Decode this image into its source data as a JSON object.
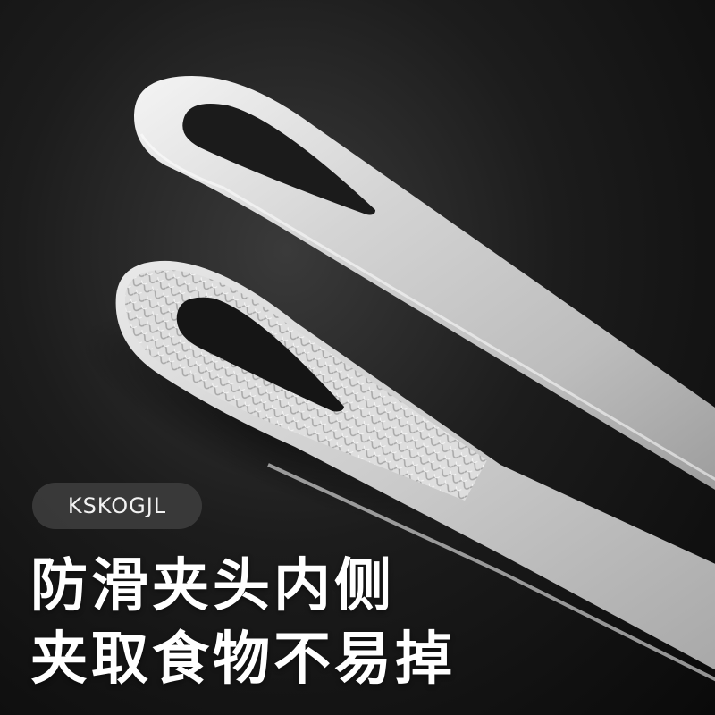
{
  "brand": {
    "name": "KSKOGJL"
  },
  "headline": {
    "line1": "防滑夹头内侧",
    "line2": "夹取食物不易掉"
  },
  "colors": {
    "background": "#1a1a1a",
    "metal": "#cfcfcf",
    "pill": "#3c3c3c",
    "text": "#ffffff"
  }
}
